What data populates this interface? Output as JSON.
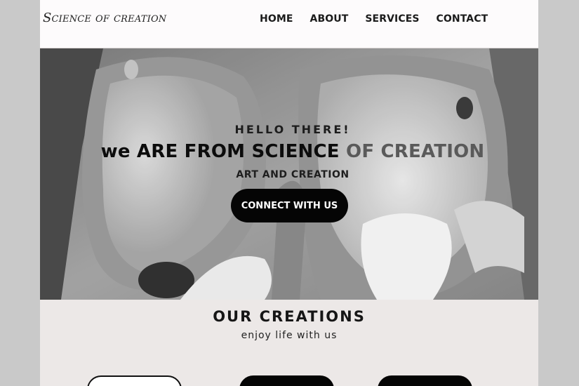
{
  "nav": {
    "logo": "Science of creation",
    "links": [
      "HOME",
      "ABOUT",
      "SERVICES",
      "CONTACT"
    ]
  },
  "hero": {
    "greeting": "HELLO THERE!",
    "title_part1": "we ARE FROM SCIENCE",
    "title_part2": "OF CREATION",
    "subtitle": "ART AND CREATION",
    "cta": "CONNECT WITH US"
  },
  "creations": {
    "title": "OUR CREATIONS",
    "subtitle": "enjoy life with us"
  }
}
